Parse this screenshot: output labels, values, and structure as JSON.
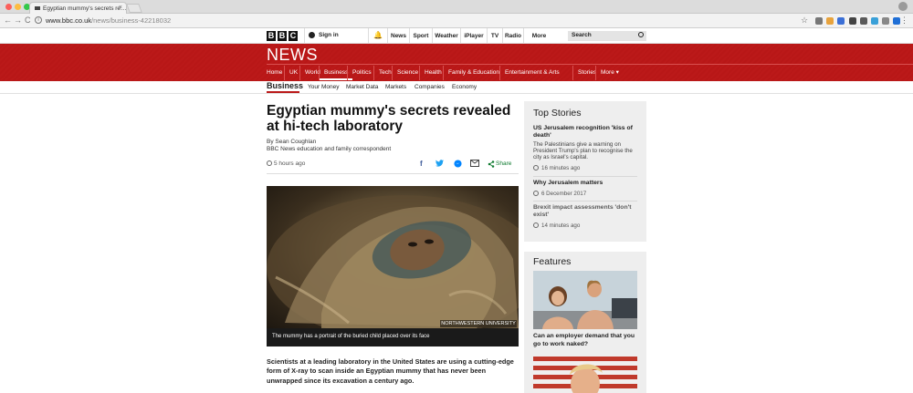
{
  "browser": {
    "tab_title": "Egyptian mummy's secrets re…",
    "tab_close": "×",
    "url_host": "www.bbc.co.uk",
    "url_path": "/news/business-42218032",
    "back_icon": "←",
    "forward_icon": "→",
    "reload_icon": "C",
    "star_icon": "☆",
    "menu_icon": "⋮",
    "traffic_colors": [
      "#fc605c",
      "#fdbc40",
      "#34c84a"
    ],
    "extension_colors": [
      "#777777",
      "#e8a33d",
      "#3b6fd6",
      "#444444",
      "#5a5a5a",
      "#3aa0d8",
      "#888888",
      "#1f6fd6"
    ]
  },
  "bbc_bar": {
    "logo_letters": [
      "B",
      "B",
      "C"
    ],
    "sign_in": "Sign in",
    "nav": [
      "News",
      "Sport",
      "Weather",
      "iPlayer",
      "TV",
      "Radio",
      "More"
    ],
    "more_caret": "▾",
    "search_placeholder": "Search"
  },
  "header": {
    "brand": "NEWS",
    "accent_color": "#bb1919",
    "nav": [
      "Home",
      "UK",
      "World",
      "Business",
      "Politics",
      "Tech",
      "Science",
      "Health",
      "Family & Education",
      "Entertainment & Arts",
      "Stories",
      "More ▾"
    ],
    "selected": "Business"
  },
  "subnav": {
    "section": "Business",
    "items": [
      "Your Money",
      "Market Data",
      "Markets",
      "Companies",
      "Economy"
    ]
  },
  "article": {
    "title": "Egyptian mummy's secrets revealed at hi-tech laboratory",
    "author": "By Sean Coughlan",
    "author_role": "BBC News education and family correspondent",
    "time": "5 hours ago",
    "share_label": "Share",
    "share_icons": [
      "facebook-icon",
      "twitter-icon",
      "messenger-icon",
      "email-icon",
      "share-icon"
    ],
    "image_credit": "NORTHWESTERN UNIVERSITY",
    "caption": "The mummy has a portrait of the buried child placed over its face",
    "lede": "Scientists at a leading laboratory in the United States are using a cutting-edge form of X-ray to scan inside an Egyptian mummy that has never been unwrapped since its excavation a century ago."
  },
  "top_stories": {
    "heading": "Top Stories",
    "items": [
      {
        "title": "US Jerusalem recognition 'kiss of death'",
        "summary": "The Palestinians give a warning on President Trump's plan to recognise the city as Israel's capital.",
        "time": "16 minutes ago"
      },
      {
        "title": "Why Jerusalem matters",
        "summary": "",
        "time": "6 December 2017"
      },
      {
        "title": "Brexit impact assessments 'don't exist'",
        "summary": "",
        "time": "14 minutes ago"
      }
    ]
  },
  "features": {
    "heading": "Features",
    "items": [
      {
        "title": "Can an employer demand that you go to work naked?"
      }
    ]
  }
}
